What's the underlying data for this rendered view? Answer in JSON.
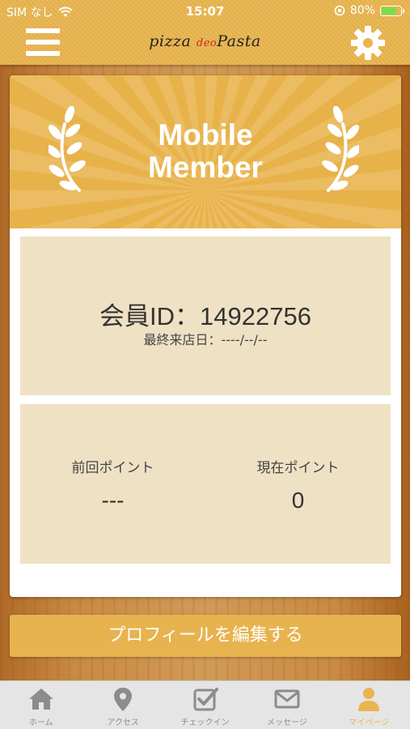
{
  "status_bar": {
    "carrier": "SIM なし",
    "time": "15:07",
    "battery": "80%",
    "battery_level": 0.8
  },
  "header": {
    "logo_text_a": "pizza",
    "logo_text_b": "deo",
    "logo_text_c": "Pasta"
  },
  "card": {
    "banner_title_line1": "Mobile",
    "banner_title_line2": "Member",
    "member_id": "会員ID：14922756",
    "last_visit": "最終来店日：----/--/--",
    "previous_points_label": "前回ポイント",
    "previous_points_value": "---",
    "current_points_label": "現在ポイント",
    "current_points_value": "0"
  },
  "edit_profile_button": "プロフィールを編集する",
  "tabs": [
    {
      "label": "ホーム",
      "icon": "home-icon"
    },
    {
      "label": "アクセス",
      "icon": "location-pin-icon"
    },
    {
      "label": "チェックイン",
      "icon": "checkbox-icon"
    },
    {
      "label": "メッセージ",
      "icon": "envelope-icon"
    },
    {
      "label": "マイページ",
      "icon": "person-icon",
      "active": true
    }
  ],
  "colors": {
    "header": "#e9b54f",
    "banner": "#e8b24a",
    "panel": "#efe1c4",
    "active_tab": "#e9b54f",
    "inactive_tab": "#8c8c8c"
  }
}
